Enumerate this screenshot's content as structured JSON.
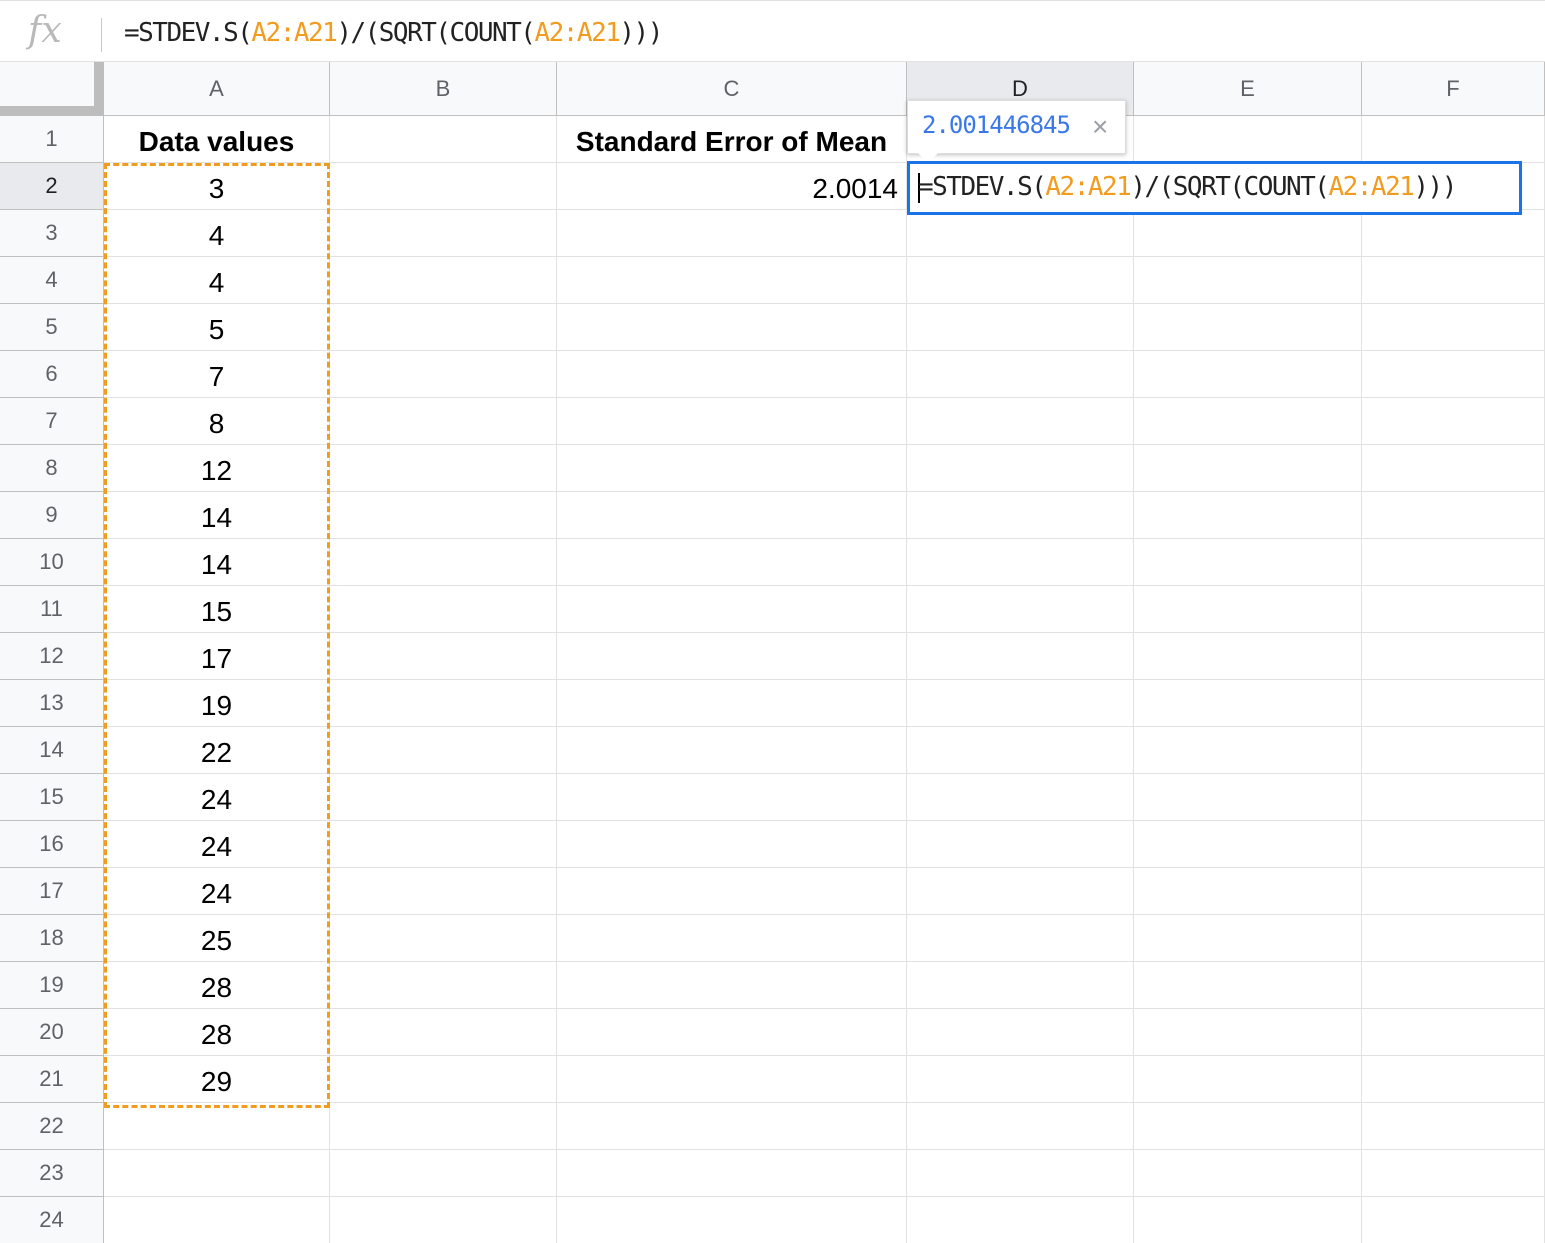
{
  "formula_bar": {
    "fx_label": "fx",
    "formula_prefix": "=STDEV.S(",
    "formula_ref1": "A2:A21",
    "formula_mid": ")/(SQRT(COUNT(",
    "formula_ref2": "A2:A21",
    "formula_suffix": ")))"
  },
  "columns": [
    "A",
    "B",
    "C",
    "D",
    "E",
    "F"
  ],
  "active_column": "D",
  "rows": [
    "1",
    "2",
    "3",
    "4",
    "5",
    "6",
    "7",
    "8",
    "9",
    "10",
    "11",
    "12",
    "13",
    "14",
    "15",
    "16",
    "17",
    "18",
    "19",
    "20",
    "21",
    "22",
    "23",
    "24"
  ],
  "active_row": "2",
  "cells": {
    "A1": "Data values",
    "C1": "Standard Error of Mean",
    "C2": "2.0014",
    "A_values": [
      "3",
      "4",
      "4",
      "5",
      "7",
      "8",
      "12",
      "14",
      "14",
      "15",
      "17",
      "19",
      "22",
      "24",
      "24",
      "24",
      "25",
      "28",
      "28",
      "29"
    ]
  },
  "editor": {
    "prefix": "=STDEV.S(",
    "ref1": "A2:A21",
    "mid": ")/(SQRT(COUNT(",
    "ref2": "A2:A21",
    "suffix": ")))"
  },
  "tooltip": {
    "value": "2.001446845",
    "close_label": "×"
  },
  "colors": {
    "range_highlight": "#f29c1f",
    "active_border": "#1a73e8",
    "tooltip_value": "#3b78e7"
  }
}
